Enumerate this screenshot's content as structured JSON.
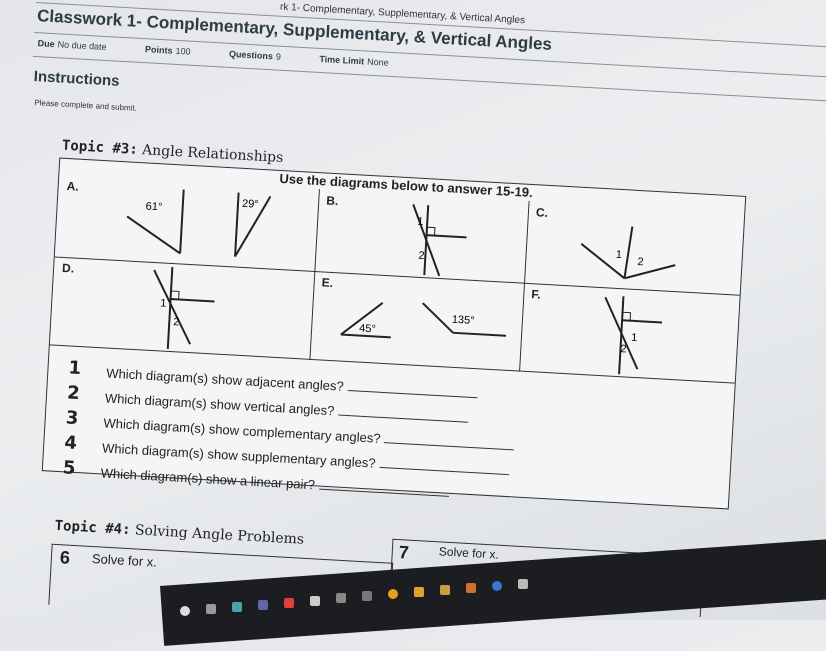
{
  "breadcrumb": "rk 1- Complementary, Supplementary, & Vertical Angles",
  "quiz": {
    "title": "Classwork 1- Complementary, Supplementary, & Vertical Angles",
    "meta": [
      {
        "label": "Due",
        "value": "No due date"
      },
      {
        "label": "Points",
        "value": "100"
      },
      {
        "label": "Questions",
        "value": "9"
      },
      {
        "label": "Time Limit",
        "value": "None"
      }
    ],
    "instructions_heading": "Instructions",
    "instructions_text": "Please complete and submit."
  },
  "worksheet": {
    "topic3": {
      "prefix": "Topic #3:",
      "title": "Angle Relationships"
    },
    "caption": "Use the diagrams below to answer 15-19.",
    "diagrams": [
      {
        "letter": "A.",
        "labels": [
          "61°",
          "29°"
        ]
      },
      {
        "letter": "B.",
        "labels": [
          "1",
          "2"
        ]
      },
      {
        "letter": "C.",
        "labels": [
          "1",
          "2"
        ]
      },
      {
        "letter": "D.",
        "labels": [
          "1",
          "2"
        ]
      },
      {
        "letter": "E.",
        "labels": [
          "45°",
          "135°"
        ]
      },
      {
        "letter": "F.",
        "labels": [
          "1",
          "2"
        ]
      }
    ],
    "questions": [
      {
        "num": "1",
        "text": "Which diagram(s) show adjacent angles?"
      },
      {
        "num": "2",
        "text": "Which diagram(s) show vertical angles?"
      },
      {
        "num": "3",
        "text": "Which diagram(s) show complementary angles?"
      },
      {
        "num": "4",
        "text": "Which diagram(s) show supplementary angles?"
      },
      {
        "num": "5",
        "text": "Which diagram(s) show a linear pair?"
      }
    ],
    "topic4": {
      "prefix": "Topic #4:",
      "title": "Solving Angle Problems"
    },
    "problems": [
      {
        "num": "6",
        "text": "Solve for x."
      },
      {
        "num": "7",
        "text": "Solve for x."
      }
    ]
  },
  "taskbar": {
    "icons": [
      "search-icon",
      "task-view-icon",
      "file-explorer-icon",
      "teams-icon",
      "app-icon",
      "steam-icon",
      "app-icon",
      "calculator-icon",
      "chrome-icon",
      "mail-icon",
      "folder-icon",
      "app-icon",
      "chrome-icon",
      "settings-icon"
    ],
    "icon_colors": [
      "#dddddd",
      "#999999",
      "#4aa3a8",
      "#6264a7",
      "#e04040",
      "#cccccc",
      "#888888",
      "#777777",
      "#e8a020",
      "#e0a030",
      "#c8a040",
      "#d07030",
      "#3a78d0",
      "#bbbbbb"
    ]
  }
}
